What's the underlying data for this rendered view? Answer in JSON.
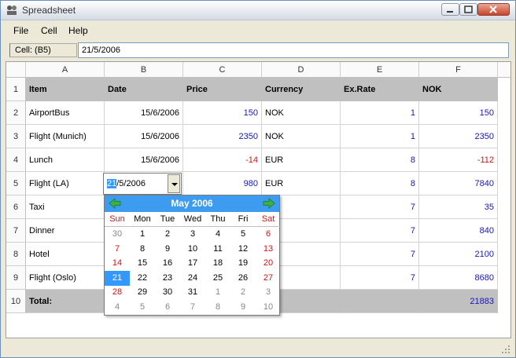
{
  "window": {
    "title": "Spreadsheet"
  },
  "menu": [
    "File",
    "Cell",
    "Help"
  ],
  "cellbar": {
    "ref": "Cell: (B5)",
    "value": "21/5/2006"
  },
  "columns": [
    "A",
    "B",
    "C",
    "D",
    "E",
    "F"
  ],
  "rows": [
    "1",
    "2",
    "3",
    "4",
    "5",
    "6",
    "7",
    "8",
    "9",
    "10"
  ],
  "header_row": [
    "Item",
    "Date",
    "Price",
    "Currency",
    "Ex.Rate",
    "NOK"
  ],
  "data_rows": [
    [
      "AirportBus",
      "15/6/2006",
      "150",
      "NOK",
      "1",
      "150"
    ],
    [
      "Flight (Munich)",
      "15/6/2006",
      "2350",
      "NOK",
      "1",
      "2350"
    ],
    [
      "Lunch",
      "15/6/2006",
      "-14",
      "EUR",
      "8",
      "-112"
    ],
    [
      "Flight (LA)",
      "",
      "980",
      "EUR",
      "8",
      "7840"
    ],
    [
      "Taxi",
      "",
      "",
      "",
      "7",
      "35"
    ],
    [
      "Dinner",
      "",
      "",
      "",
      "7",
      "840"
    ],
    [
      "Hotel",
      "",
      "",
      "",
      "7",
      "2100"
    ],
    [
      "Flight (Oslo)",
      "",
      "",
      "",
      "7",
      "8680"
    ]
  ],
  "total_row": {
    "label": "Total:",
    "value": "21883"
  },
  "editor": {
    "selected": "21",
    "rest": "/5/2006"
  },
  "calendar": {
    "month_label": "May  2006",
    "weekdays": [
      "Sun",
      "Mon",
      "Tue",
      "Wed",
      "Thu",
      "Fri",
      "Sat"
    ],
    "weeks": [
      [
        "30",
        "1",
        "2",
        "3",
        "4",
        "5",
        "6"
      ],
      [
        "7",
        "8",
        "9",
        "10",
        "11",
        "12",
        "13"
      ],
      [
        "14",
        "15",
        "16",
        "17",
        "18",
        "19",
        "20"
      ],
      [
        "21",
        "22",
        "23",
        "24",
        "25",
        "26",
        "27"
      ],
      [
        "28",
        "29",
        "30",
        "31",
        "1",
        "2",
        "3"
      ],
      [
        "4",
        "5",
        "6",
        "7",
        "8",
        "9",
        "10"
      ]
    ],
    "selected_day": "21",
    "colors": {
      "header": "#3d9bf0",
      "weekend": "#d21414",
      "selection": "#3399ff",
      "arrow": "#3cb043"
    }
  }
}
